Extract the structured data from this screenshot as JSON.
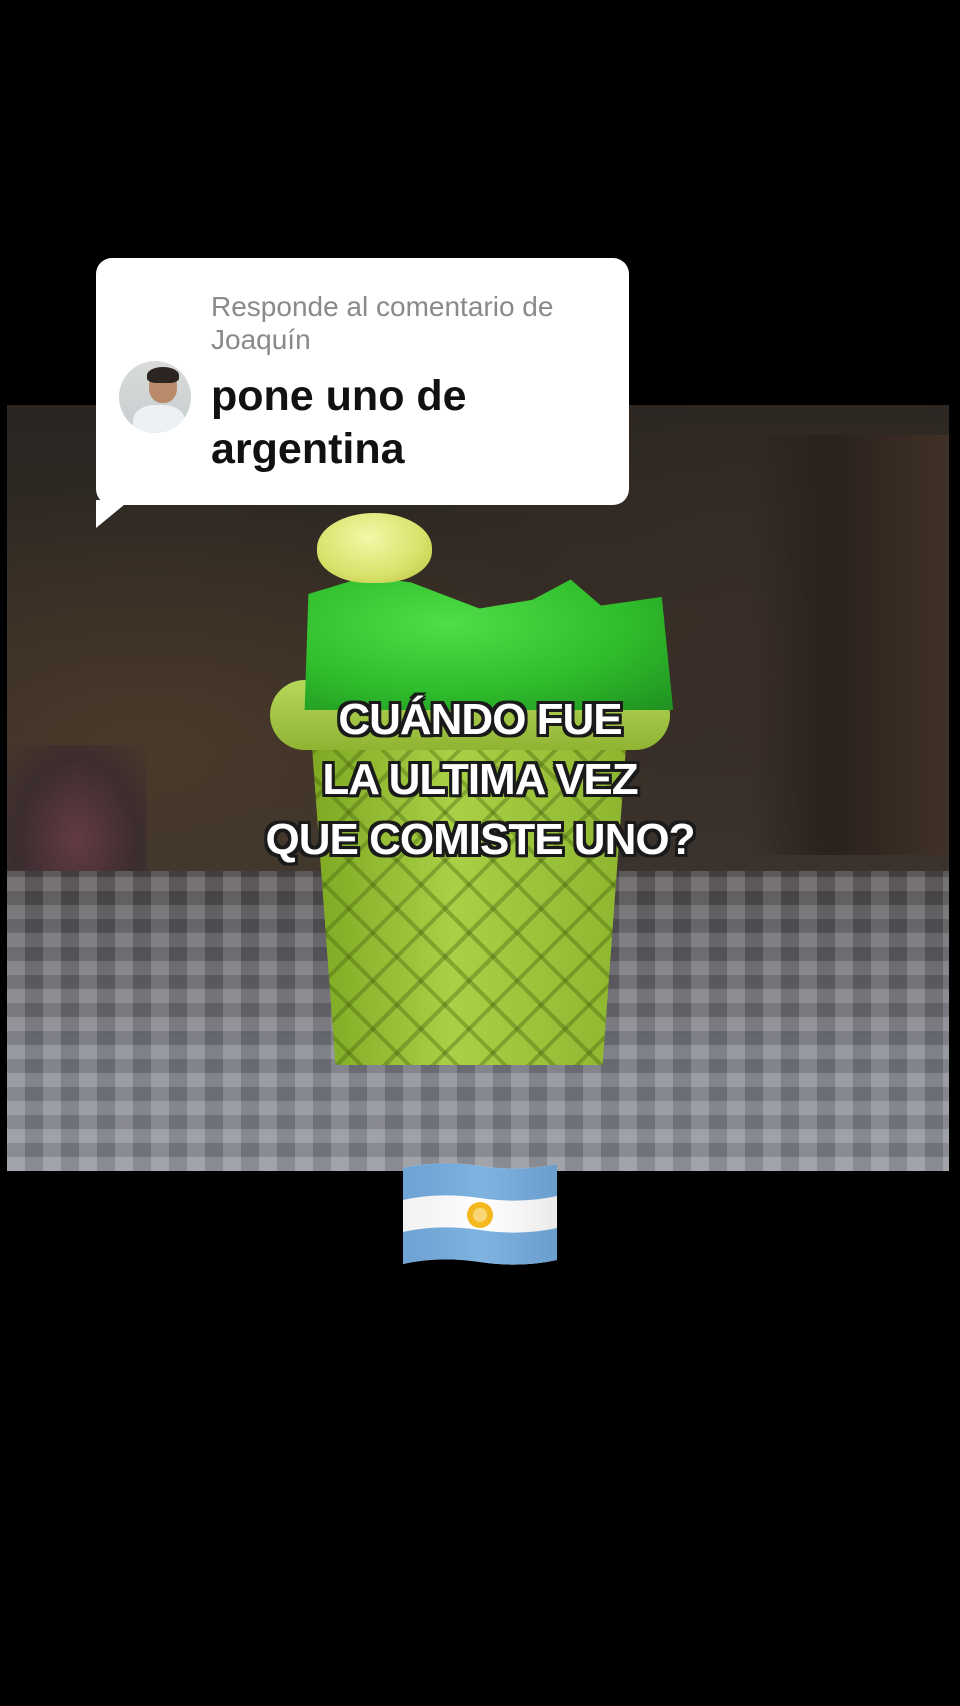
{
  "reply": {
    "header": "Responde al comentario de Joaquín",
    "comment": "pone uno de argentina",
    "avatar": "user-avatar"
  },
  "caption": {
    "lines": [
      "CUÁNDO FUE",
      "LA ULTIMA VEZ",
      "QUE COMISTE UNO?"
    ]
  },
  "emoji": {
    "name": "argentina-flag-emoji",
    "colors": {
      "celeste": "#74acdf",
      "white": "#ffffff",
      "sun": "#f6b40e"
    }
  }
}
